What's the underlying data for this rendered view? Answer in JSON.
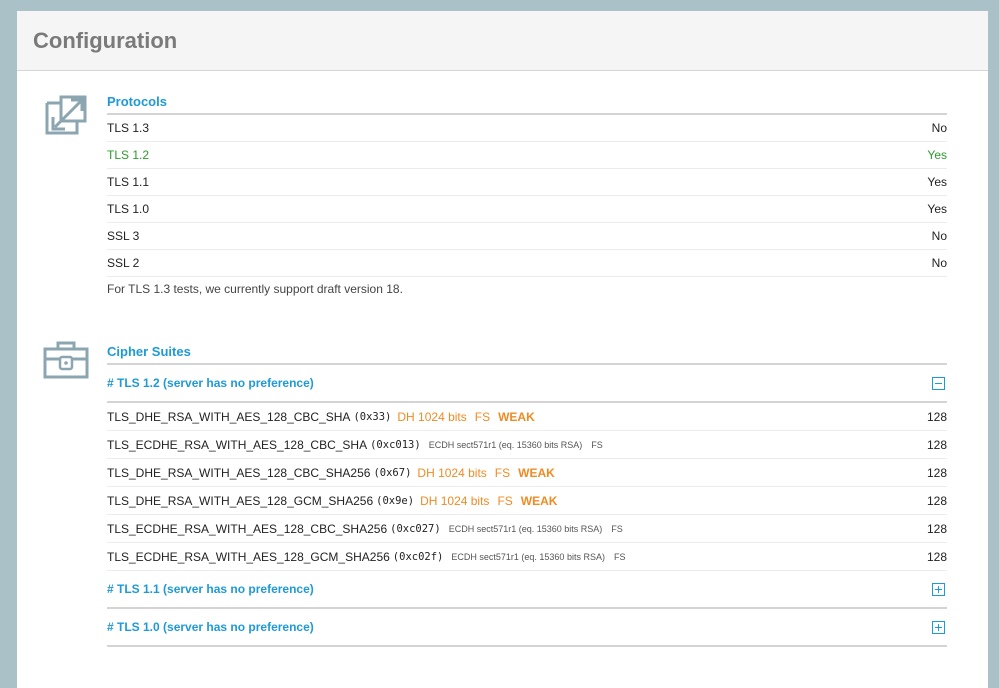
{
  "title": "Configuration",
  "protocols": {
    "title": "Protocols",
    "rows": [
      {
        "name": "TLS 1.3",
        "value": "No",
        "highlight": false
      },
      {
        "name": "TLS 1.2",
        "value": "Yes",
        "highlight": true
      },
      {
        "name": "TLS 1.1",
        "value": "Yes",
        "highlight": false
      },
      {
        "name": "TLS 1.0",
        "value": "Yes",
        "highlight": false
      },
      {
        "name": "SSL 3",
        "value": "No",
        "highlight": false
      },
      {
        "name": "SSL 2",
        "value": "No",
        "highlight": false
      }
    ],
    "note": "For TLS 1.3 tests, we currently support draft version 18."
  },
  "ciphers": {
    "title": "Cipher Suites",
    "groups": [
      {
        "label": "# TLS 1.2 (server has no preference)",
        "expanded": true,
        "rows": [
          {
            "name": "TLS_DHE_RSA_WITH_AES_128_CBC_SHA",
            "hex": "(0x33)",
            "dh": "DH 1024 bits",
            "ecdh": "",
            "fs": "FS",
            "weak": "WEAK",
            "bits": "128"
          },
          {
            "name": "TLS_ECDHE_RSA_WITH_AES_128_CBC_SHA",
            "hex": "(0xc013)",
            "dh": "",
            "ecdh": "ECDH sect571r1 (eq. 15360 bits RSA)",
            "fs": "FS",
            "weak": "",
            "bits": "128"
          },
          {
            "name": "TLS_DHE_RSA_WITH_AES_128_CBC_SHA256",
            "hex": "(0x67)",
            "dh": "DH 1024 bits",
            "ecdh": "",
            "fs": "FS",
            "weak": "WEAK",
            "bits": "128"
          },
          {
            "name": "TLS_DHE_RSA_WITH_AES_128_GCM_SHA256",
            "hex": "(0x9e)",
            "dh": "DH 1024 bits",
            "ecdh": "",
            "fs": "FS",
            "weak": "WEAK",
            "bits": "128"
          },
          {
            "name": "TLS_ECDHE_RSA_WITH_AES_128_CBC_SHA256",
            "hex": "(0xc027)",
            "dh": "",
            "ecdh": "ECDH sect571r1 (eq. 15360 bits RSA)",
            "fs": "FS",
            "weak": "",
            "bits": "128"
          },
          {
            "name": "TLS_ECDHE_RSA_WITH_AES_128_GCM_SHA256",
            "hex": "(0xc02f)",
            "dh": "",
            "ecdh": "ECDH sect571r1 (eq. 15360 bits RSA)",
            "fs": "FS",
            "weak": "",
            "bits": "128"
          }
        ]
      },
      {
        "label": "# TLS 1.1 (server has no preference)",
        "expanded": false,
        "rows": []
      },
      {
        "label": "# TLS 1.0 (server has no preference)",
        "expanded": false,
        "rows": []
      }
    ]
  },
  "colors": {
    "accent": "#1e9ad6",
    "ok": "#2a9d2a",
    "warning": "#f08b24",
    "frame": "#a9c1c7"
  },
  "icons": {
    "protocols": "expand-arrows-icon",
    "ciphers": "toolbox-lock-icon",
    "collapse": "minus-box-icon",
    "expand": "plus-box-icon"
  }
}
